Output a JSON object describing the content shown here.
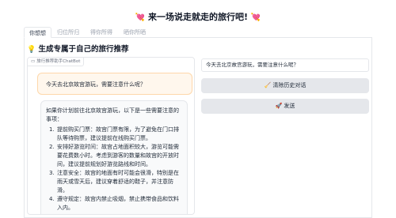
{
  "page": {
    "title": "来一场说走就走的旅行吧!",
    "title_emoji_left": "💘",
    "title_emoji_right": "💘"
  },
  "tabs": [
    {
      "label": "你想想",
      "active": true
    },
    {
      "label": "归位所归",
      "active": false
    },
    {
      "label": "得你所得",
      "active": false
    },
    {
      "label": "晒你所晒",
      "active": false
    }
  ],
  "section": {
    "icon": "💡",
    "title": "生成专属于自己的旅行推荐"
  },
  "chatbot": {
    "label": "旅行推荐助手ChatBot",
    "user_message": "今天去北京故宫游玩，需要注意什么呢？",
    "bot_intro": "如果你计划前往北京故宫游玩，以下是一些需要注意的事项：",
    "bot_items": [
      {
        "num": "1.",
        "text": "提前购买门票：故宫门票有限，为了避免在门口排队等待购票，建议提前在线购买门票。"
      },
      {
        "num": "2.",
        "text": "安排好游览时间：故宫占地面积较大，游览可能需要花费数小时。考虑到游客的数量和故宫的开放时间，建议提前规划好游览路线和时间。"
      },
      {
        "num": "3.",
        "text": "注意安全：故宫的地面有时可能会很滑，特别是在雨天或雪天后，建议穿着舒适的鞋子，并注意防滑。"
      },
      {
        "num": "4.",
        "text": "遵守规定：故宫内禁止吸烟，禁止携带食品和饮料入内。"
      }
    ]
  },
  "input": {
    "value": "今天去北京故宫游玩，需要注意什么呢？"
  },
  "buttons": {
    "clear_icon": "🧹",
    "clear_label": "清除历史对话",
    "send_icon": "🚀",
    "send_label": "发送"
  }
}
